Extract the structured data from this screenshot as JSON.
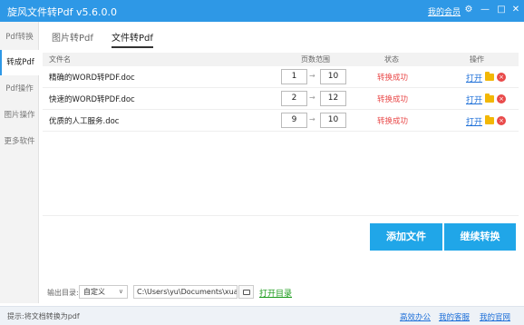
{
  "window": {
    "title": "旋风文件转Pdf v5.6.0.0",
    "member_link": "我的会员",
    "icons": [
      "settings-icon",
      "minimize-icon",
      "maximize-icon",
      "close-icon"
    ]
  },
  "sidebar": {
    "items": [
      {
        "label": "Pdf转换",
        "active": false
      },
      {
        "label": "转成Pdf",
        "active": true
      },
      {
        "label": "Pdf操作",
        "active": false
      },
      {
        "label": "图片操作",
        "active": false
      },
      {
        "label": "更多软件",
        "active": false
      }
    ]
  },
  "tabs": [
    {
      "label": "图片转Pdf",
      "active": false
    },
    {
      "label": "文件转Pdf",
      "active": true
    }
  ],
  "table": {
    "headers": {
      "name": "文件名",
      "pages": "页数范围",
      "status": "状态",
      "action": "操作"
    },
    "rows": [
      {
        "name": "精确的WORD转PDF.doc",
        "from": "1",
        "to": "10",
        "status": "转换成功",
        "open": "打开"
      },
      {
        "name": "快速的WORD转PDF.doc",
        "from": "2",
        "to": "12",
        "status": "转换成功",
        "open": "打开"
      },
      {
        "name": "优质的人工服务.doc",
        "from": "9",
        "to": "10",
        "status": "转换成功",
        "open": "打开"
      }
    ]
  },
  "buttons": {
    "add_file": "添加文件",
    "convert": "继续转换"
  },
  "output": {
    "label": "输出目录:",
    "mode": "自定义",
    "path": "C:\\Users\\yu\\Documents\\xuanfeng",
    "open_dir": "打开目录"
  },
  "statusbar": {
    "tip": "提示:将文档转换为pdf",
    "links": [
      "高效办公",
      "我的客服",
      "我的官网"
    ]
  },
  "colors": {
    "accent": "#2e98e6",
    "button": "#20a6e8",
    "success_text": "#e94a4a",
    "open_dir": "#1a9a1a"
  }
}
